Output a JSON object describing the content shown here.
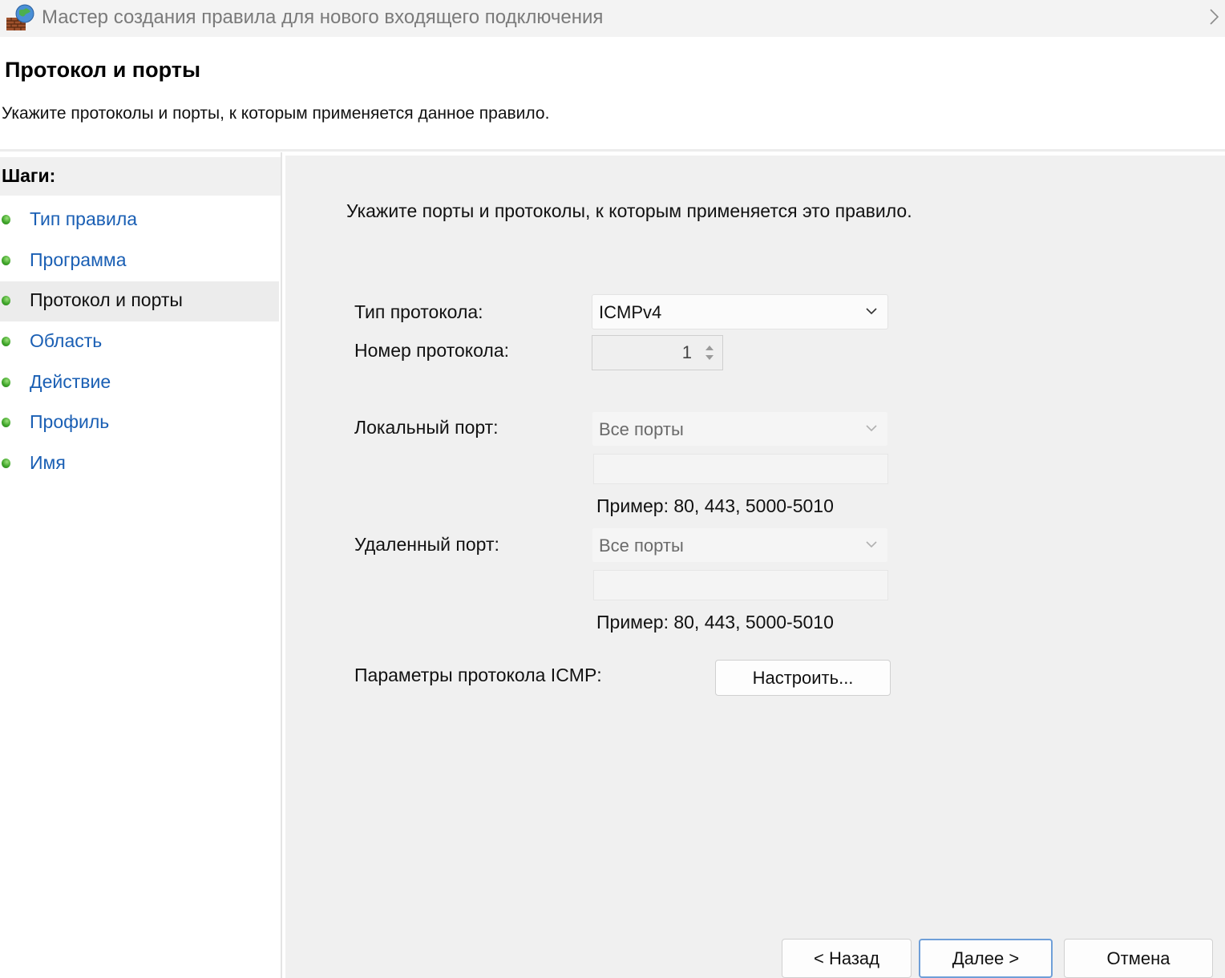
{
  "window": {
    "title": "Мастер создания правила для нового входящего подключения",
    "icon": "firewall-globe-icon"
  },
  "header": {
    "title": "Протокол и порты",
    "subtitle": "Укажите протоколы и порты, к которым применяется данное правило."
  },
  "sidebar": {
    "heading": "Шаги:",
    "items": [
      {
        "label": "Тип правила",
        "active": false
      },
      {
        "label": "Программа",
        "active": false
      },
      {
        "label": "Протокол и порты",
        "active": true
      },
      {
        "label": "Область",
        "active": false
      },
      {
        "label": "Действие",
        "active": false
      },
      {
        "label": "Профиль",
        "active": false
      },
      {
        "label": "Имя",
        "active": false
      }
    ]
  },
  "main": {
    "description": "Укажите порты и протоколы, к которым применяется это правило.",
    "protocol_type": {
      "label": "Тип протокола:",
      "value": "ICMPv4"
    },
    "protocol_number": {
      "label": "Номер протокола:",
      "value": "1"
    },
    "local_port": {
      "label": "Локальный порт:",
      "value": "Все порты",
      "example": "Пример: 80, 443, 5000-5010"
    },
    "remote_port": {
      "label": "Удаленный порт:",
      "value": "Все порты",
      "example": "Пример: 80, 443, 5000-5010"
    },
    "icmp": {
      "label": "Параметры протокола ICMP:",
      "button": "Настроить..."
    }
  },
  "footer": {
    "back": "< Назад",
    "next": "Далее >",
    "cancel": "Отмена"
  },
  "colors": {
    "link": "#1a5fb4",
    "panel_bg": "#f0f0f0",
    "primary_border": "#6f9fd8"
  }
}
